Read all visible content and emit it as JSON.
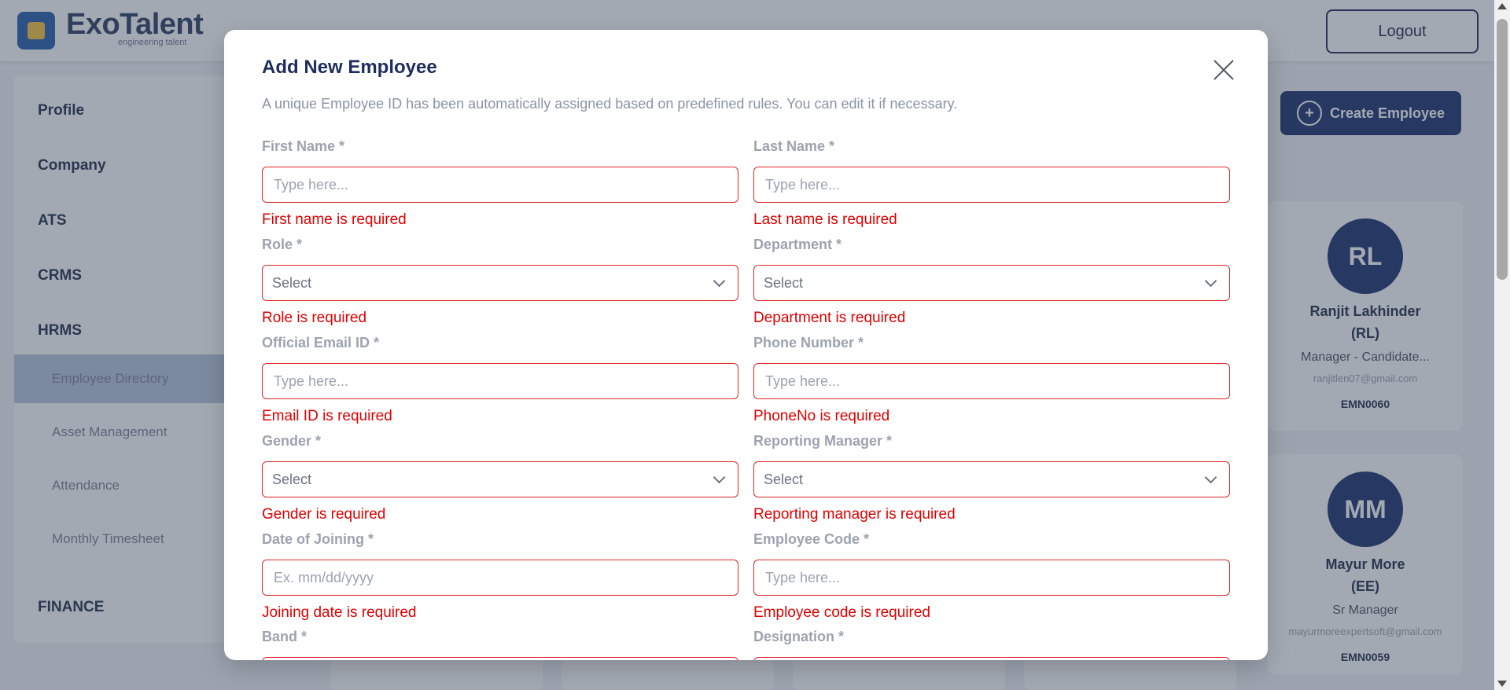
{
  "app": {
    "brand": "ExoTalent",
    "brand_sub": "engineering talent",
    "logout_label": "Logout"
  },
  "sidebar": {
    "items": [
      {
        "label": "Profile"
      },
      {
        "label": "Company"
      },
      {
        "label": "ATS"
      },
      {
        "label": "CRMS"
      },
      {
        "label": "HRMS"
      }
    ],
    "sub_items": [
      {
        "label": "Employee Directory"
      },
      {
        "label": "Asset Management"
      },
      {
        "label": "Attendance"
      },
      {
        "label": "Monthly Timesheet"
      }
    ],
    "finance_label": "FINANCE"
  },
  "main": {
    "create_button": "Create Employee",
    "cards": [
      {
        "initials": "RL",
        "name": "Ranjit Lakhinder",
        "code_tag": "(RL)",
        "role": "Manager - Candidate...",
        "email": "ranjitlen07@gmail.com",
        "id": "EMN0060"
      },
      {
        "initials": "MM",
        "name": "Mayur More",
        "code_tag": "(EE)",
        "role": "Sr Manager",
        "email": "mayurmoreexpertsoft@gmail.com",
        "id": "EMN0059"
      }
    ]
  },
  "modal": {
    "title": "Add New Employee",
    "description": "A unique Employee ID has been automatically assigned based on predefined rules. You can edit it if necessary.",
    "fields": {
      "first_name": {
        "label": "First Name *",
        "placeholder": "Type here...",
        "error": "First name is required"
      },
      "last_name": {
        "label": "Last Name *",
        "placeholder": "Type here...",
        "error": "Last name is required"
      },
      "role": {
        "label": "Role *",
        "value": "Select",
        "error": "Role is required"
      },
      "department": {
        "label": "Department *",
        "value": "Select",
        "error": "Department is required"
      },
      "email": {
        "label": "Official Email ID *",
        "placeholder": "Type here...",
        "error": "Email ID is required"
      },
      "phone": {
        "label": "Phone Number *",
        "placeholder": "Type here...",
        "error": "PhoneNo is required"
      },
      "gender": {
        "label": "Gender *",
        "value": "Select",
        "error": "Gender is required"
      },
      "manager": {
        "label": "Reporting Manager *",
        "value": "Select",
        "error": "Reporting manager is required"
      },
      "doj": {
        "label": "Date of Joining *",
        "placeholder": "Ex. mm/dd/yyyy",
        "error": "Joining date is required"
      },
      "emp_code": {
        "label": "Employee Code *",
        "placeholder": "Type here...",
        "error": "Employee code is required"
      },
      "band": {
        "label": "Band *"
      },
      "designation": {
        "label": "Designation *"
      }
    }
  }
}
